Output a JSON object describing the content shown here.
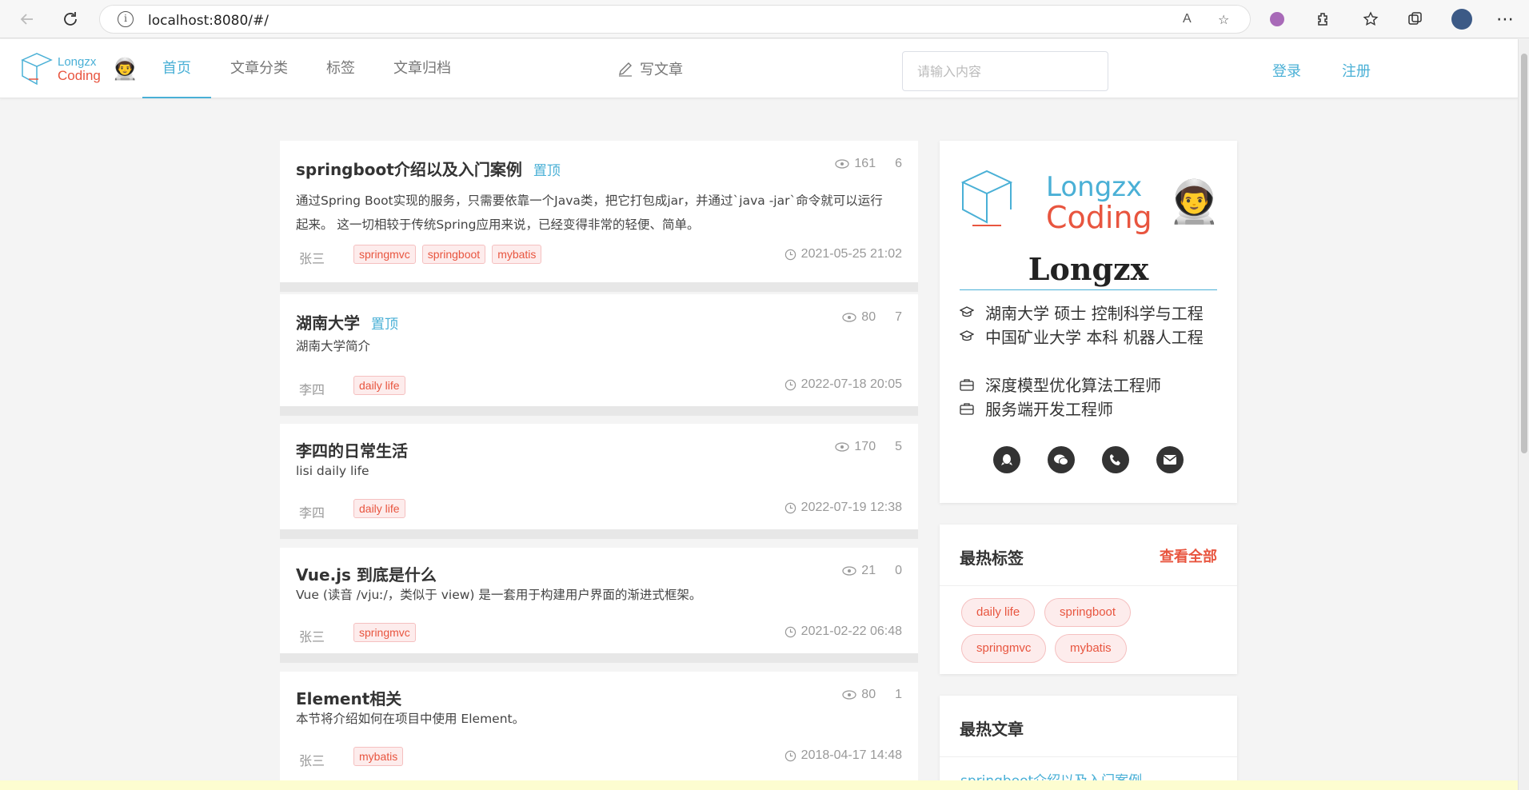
{
  "browser": {
    "url": "localhost:8080/#/"
  },
  "header": {
    "logo": {
      "line1": "Longzx",
      "line2": "Coding"
    },
    "nav": [
      "首页",
      "文章分类",
      "标签",
      "文章归档"
    ],
    "write_label": "写文章",
    "search_placeholder": "请输入内容",
    "login": "登录",
    "register": "注册"
  },
  "articles": [
    {
      "title": "springboot介绍以及入门案例",
      "top_label": "置顶",
      "views": "161",
      "comments": "6",
      "summary": "通过Spring Boot实现的服务，只需要依靠一个Java类，把它打包成jar，并通过`java -jar`命令就可以运行起来。 这一切相较于传统Spring应用来说，已经变得非常的轻便、简单。",
      "author": "张三",
      "tags": [
        "springmvc",
        "springboot",
        "mybatis"
      ],
      "date": "2021-05-25 21:02"
    },
    {
      "title": "湖南大学",
      "top_label": "置顶",
      "views": "80",
      "comments": "7",
      "summary": "湖南大学简介",
      "author": "李四",
      "tags": [
        "daily life"
      ],
      "date": "2022-07-18 20:05"
    },
    {
      "title": "李四的日常生活",
      "views": "170",
      "comments": "5",
      "summary": "lisi daily life",
      "author": "李四",
      "tags": [
        "daily life"
      ],
      "date": "2022-07-19 12:38"
    },
    {
      "title": "Vue.js 到底是什么",
      "views": "21",
      "comments": "0",
      "summary": "Vue (读音 /vjuː/，类似于 view) 是一套用于构建用户界面的渐进式框架。",
      "author": "张三",
      "tags": [
        "springmvc"
      ],
      "date": "2021-02-22 06:48"
    },
    {
      "title": "Element相关",
      "views": "80",
      "comments": "1",
      "summary": "本节将介绍如何在项目中使用 Element。",
      "author": "张三",
      "tags": [
        "mybatis"
      ],
      "date": "2018-04-17 14:48"
    }
  ],
  "profile": {
    "logo_line1": "Longzx",
    "logo_line2": "Coding",
    "name": "Longzx",
    "education": [
      "湖南大学 硕士 控制科学与工程",
      "中国矿业大学 本科 机器人工程"
    ],
    "jobs": [
      "深度模型优化算法工程师",
      "服务端开发工程师"
    ],
    "social_icons": [
      "qq-icon",
      "wechat-icon",
      "phone-icon",
      "mail-icon"
    ]
  },
  "hot_tags": {
    "title": "最热标签",
    "see_all": "查看全部",
    "tags": [
      "daily life",
      "springboot",
      "springmvc",
      "mybatis"
    ]
  },
  "hot_articles": {
    "title": "最热文章",
    "items": [
      "springboot介绍以及入门案例"
    ]
  },
  "colors": {
    "accent": "#4ab0d6",
    "brand_red": "#e8553f"
  }
}
